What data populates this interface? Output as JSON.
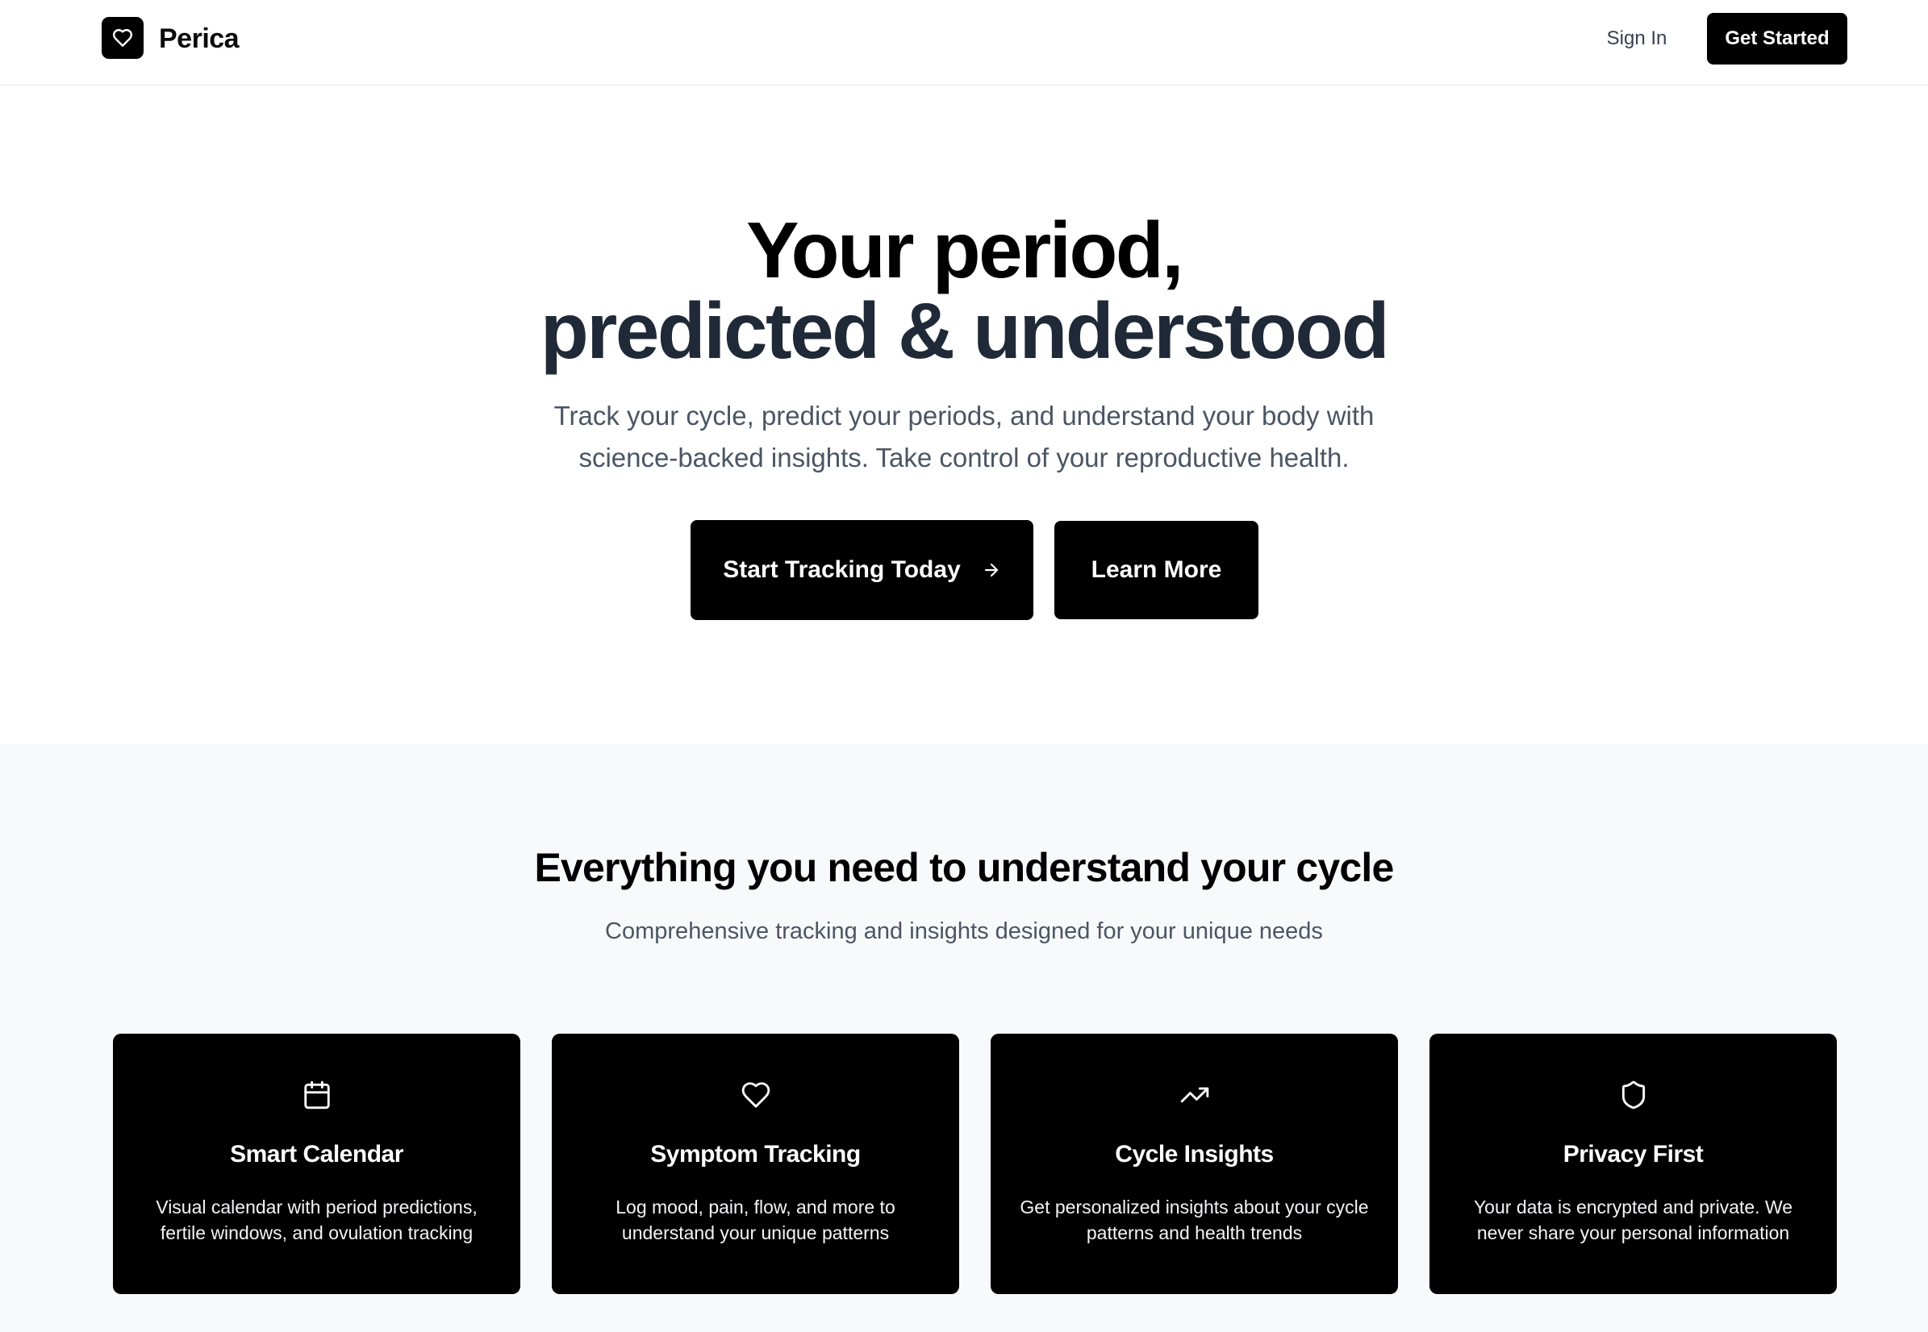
{
  "nav": {
    "brand": "Perica",
    "logo_icon": "heart-icon",
    "signin_label": "Sign In",
    "getstarted_label": "Get Started"
  },
  "hero": {
    "title_line1": "Your period,",
    "title_line2": "predicted & understood",
    "subtitle": "Track your cycle, predict your periods, and understand your body with science-backed insights. Take control of your reproductive health.",
    "primary_cta": "Start Tracking Today",
    "primary_cta_icon": "arrow-right-icon",
    "secondary_cta": "Learn More"
  },
  "features": {
    "title": "Everything you need to understand your cycle",
    "subtitle": "Comprehensive tracking and insights designed for your unique needs",
    "cards": [
      {
        "icon": "calendar-icon",
        "title": "Smart Calendar",
        "description": "Visual calendar with period predictions, fertile windows, and ovulation tracking"
      },
      {
        "icon": "heart-icon",
        "title": "Symptom Tracking",
        "description": "Log mood, pain, flow, and more to understand your unique patterns"
      },
      {
        "icon": "trending-up-icon",
        "title": "Cycle Insights",
        "description": "Get personalized insights about your cycle patterns and health trends"
      },
      {
        "icon": "shield-icon",
        "title": "Privacy First",
        "description": "Your data is encrypted and private. We never share your personal information"
      }
    ]
  },
  "colors": {
    "primary": "#000000",
    "text_muted": "#4b5563",
    "section_bg": "#f8f9fb",
    "heading_secondary": "#1f2937"
  }
}
